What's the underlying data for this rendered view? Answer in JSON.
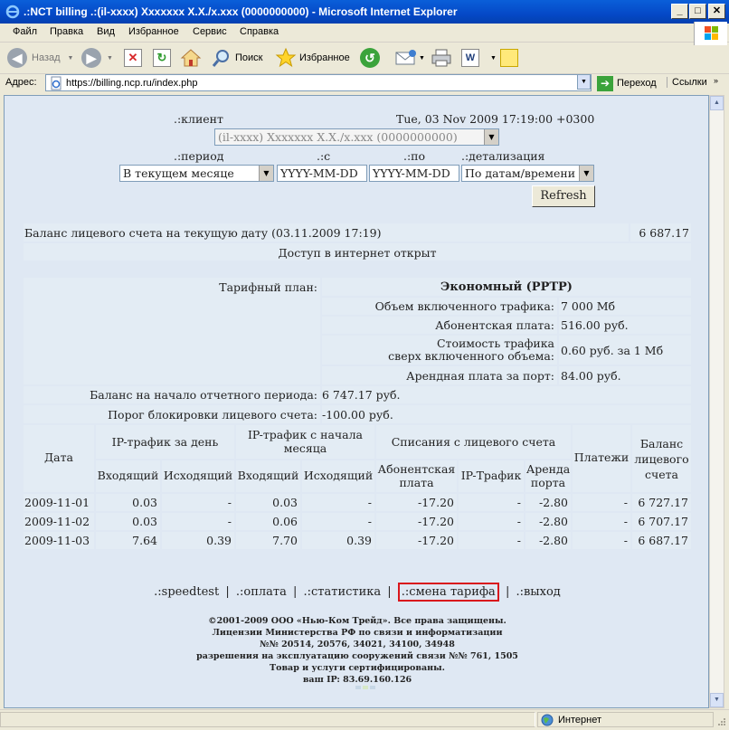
{
  "window": {
    "title": ".:NCT billing .:(il-xxxx) Xxxxxxx X.X./x.xxx (0000000000) - Microsoft Internet Explorer"
  },
  "menu": [
    "Файл",
    "Правка",
    "Вид",
    "Избранное",
    "Сервис",
    "Справка"
  ],
  "toolbar": {
    "back": "Назад",
    "search": "Поиск",
    "favorites": "Избранное"
  },
  "address": {
    "label": "Адрес:",
    "url": "https://billing.ncp.ru/index.php",
    "go": "Переход",
    "links": "Ссылки"
  },
  "status": {
    "zone": "Интернет"
  },
  "form": {
    "client_label": ".:клиент",
    "datetime": "Tue, 03 Nov 2009 17:19:00 +0300",
    "client_value": "(il-xxxx) Xxxxxxx X.X./x.xxx (0000000000)",
    "period_label": ".:период",
    "from_label": ".:с",
    "to_label": ".:по",
    "detail_label": ".:детализация",
    "period_value": "В текущем месяце",
    "from_value": "YYYY-MM-DD",
    "to_value": "YYYY-MM-DD",
    "detail_value": "По датам/времени",
    "refresh": "Refresh"
  },
  "balance": {
    "label": "Баланс лицевого счета на текущую дату (03.11.2009 17:19)",
    "value": "6 687.17",
    "access": "Доступ в интернет открыт"
  },
  "tariff": {
    "plan_label": "Тарифный план:",
    "plan_name": "Экономный (PPTP)",
    "rows": [
      {
        "label": "Объем включенного трафика:",
        "value": "7 000 Мб"
      },
      {
        "label": "Абонентская плата:",
        "value": "516.00 руб."
      },
      {
        "label1": "Стоимость трафика",
        "label2": "сверх включенного объема:",
        "value": "0.60 руб. за 1 Мб"
      },
      {
        "label": "Арендная плата за порт:",
        "value": "84.00 руб."
      }
    ],
    "start_balance_label": "Баланс на начало отчетного периода:",
    "start_balance_value": "6 747.17 руб.",
    "block_label": "Порог блокировки лицевого счета:",
    "block_value": "-100.00 руб."
  },
  "stats": {
    "headers": {
      "date": "Дата",
      "ip_day": "IP-трафик за день",
      "ip_month1": "IP-трафик с начала",
      "ip_month2": "месяца",
      "charges": "Списания с лицевого счета",
      "payments": "Платежи",
      "bal1": "Баланс",
      "bal2": "лицевого",
      "bal3": "счета",
      "in": "Входящий",
      "out": "Исходящий",
      "sub1": "Абонентская",
      "sub2": "плата",
      "iptraf": "IP-Трафик",
      "rent1": "Аренда",
      "rent2": "порта"
    },
    "rows": [
      [
        "2009-11-01",
        "0.03",
        "-",
        "0.03",
        "-",
        "-17.20",
        "-",
        "-2.80",
        "-",
        "6 727.17"
      ],
      [
        "2009-11-02",
        "0.03",
        "-",
        "0.06",
        "-",
        "-17.20",
        "-",
        "-2.80",
        "-",
        "6 707.17"
      ],
      [
        "2009-11-03",
        "7.64",
        "0.39",
        "7.70",
        "0.39",
        "-17.20",
        "-",
        "-2.80",
        "-",
        "6 687.17"
      ]
    ]
  },
  "links": {
    "speedtest": ".:speedtest",
    "pay": ".:оплата",
    "stats": ".:статистика",
    "change": ".:смена тарифа",
    "exit": ".:выход",
    "sep": "|"
  },
  "copyright": [
    "©2001-2009 ООО «Нью-Ком Трейд». Все права защищены.",
    "Лицензии Министерства РФ по связи и информатизации",
    "№№ 20514, 20576, 34021, 34100, 34948",
    "разрешения на эксплуатацию сооружений связи №№ 761, 1505",
    "Товар и услуги сертифицированы.",
    "ваш IP: 83.69.160.126"
  ]
}
